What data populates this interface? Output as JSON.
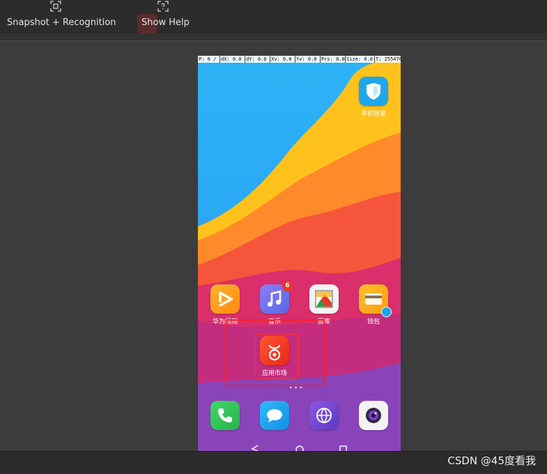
{
  "toolbar": {
    "snapshot_label": "Snapshot + Recognition",
    "help_label": "Show Help",
    "snapshot_icon": "screenshot-frame-icon",
    "help_icon": "help-frame-icon"
  },
  "phone": {
    "debug_bar": {
      "p": "P: 0 / 1",
      "dx": "dX: 0.0",
      "dy": "dY: 0.0",
      "xv": "Xv: 0.0",
      "yv": "Yv: 0.0",
      "prs": "Prs: 0.0",
      "size": "Size: 0.0",
      "t": "T: 255476"
    },
    "apps": [
      {
        "label": "手机管家",
        "icon": "shield-icon",
        "color": "#1ea7ec"
      },
      {
        "label": "华为视频",
        "icon": "play-icon",
        "color": "#ff9d1e"
      },
      {
        "label": "音乐",
        "icon": "music-note-icon",
        "color": "#7b6ff0",
        "badge": "6"
      },
      {
        "label": "图库",
        "icon": "gallery-icon",
        "color": "#f2f2f2"
      },
      {
        "label": "钱包",
        "icon": "wallet-icon",
        "color": "#ffb21e"
      },
      {
        "label": "应用市场",
        "icon": "app-store-bag-icon",
        "color": "#f23a1d"
      }
    ],
    "dock": [
      {
        "icon": "phone-icon",
        "color": "#34c759"
      },
      {
        "icon": "message-icon",
        "color": "#1ea6f0"
      },
      {
        "icon": "browser-icon",
        "color": "#7d4cd8"
      },
      {
        "icon": "camera-icon",
        "color": "#f2f2f2"
      }
    ],
    "nav": [
      "back-icon",
      "home-icon",
      "recents-icon"
    ]
  },
  "watermark": "CSDN @45度看我",
  "colors": {
    "selection": "#ff2020",
    "toolbar_bg": "#2c2c2c",
    "canvas_bg": "#3c3c3c"
  }
}
